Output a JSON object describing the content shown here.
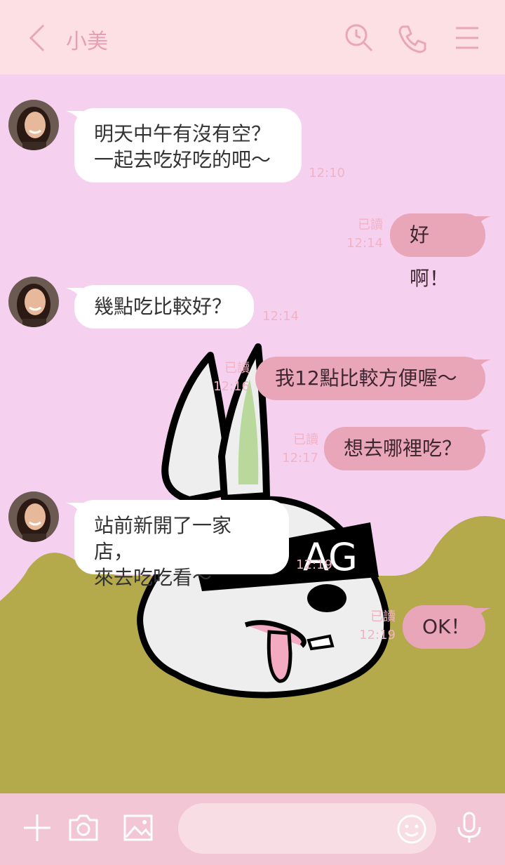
{
  "header": {
    "title": "小美"
  },
  "messages": [
    {
      "lines": [
        "明天中午有沒有空？",
        "一起去吃好吃的吧～"
      ],
      "time": "12:10"
    },
    {
      "text": "好啊！",
      "read": "已讀",
      "time": "12:14"
    },
    {
      "lines": [
        "幾點吃比較好？"
      ],
      "time": "12:14"
    },
    {
      "text": "我12點比較方便喔～",
      "read": "已讀",
      "time": "12:16"
    },
    {
      "text": "想去哪裡吃？",
      "read": "已讀",
      "time": "12:17"
    },
    {
      "lines": [
        "站前新開了一家店，",
        "來去吃吃看～"
      ],
      "time": "12:19"
    },
    {
      "text": "OK！",
      "read": "已讀",
      "time": "12:19"
    }
  ],
  "background": {
    "sign_text": "AG",
    "sky_color": "#f6d0ef",
    "hill_color": "#b4a94b"
  },
  "input": {
    "placeholder": ""
  },
  "colors": {
    "accent": "#e9a6b9",
    "header": "#fde0e3",
    "toolbar": "#f2c6d4"
  },
  "icons": {
    "back": "chevron-left-icon",
    "search": "search-icon",
    "call": "phone-icon",
    "menu": "menu-icon",
    "add": "plus-icon",
    "camera": "camera-icon",
    "image": "image-icon",
    "emoji": "emoji-icon",
    "mic": "microphone-icon"
  }
}
